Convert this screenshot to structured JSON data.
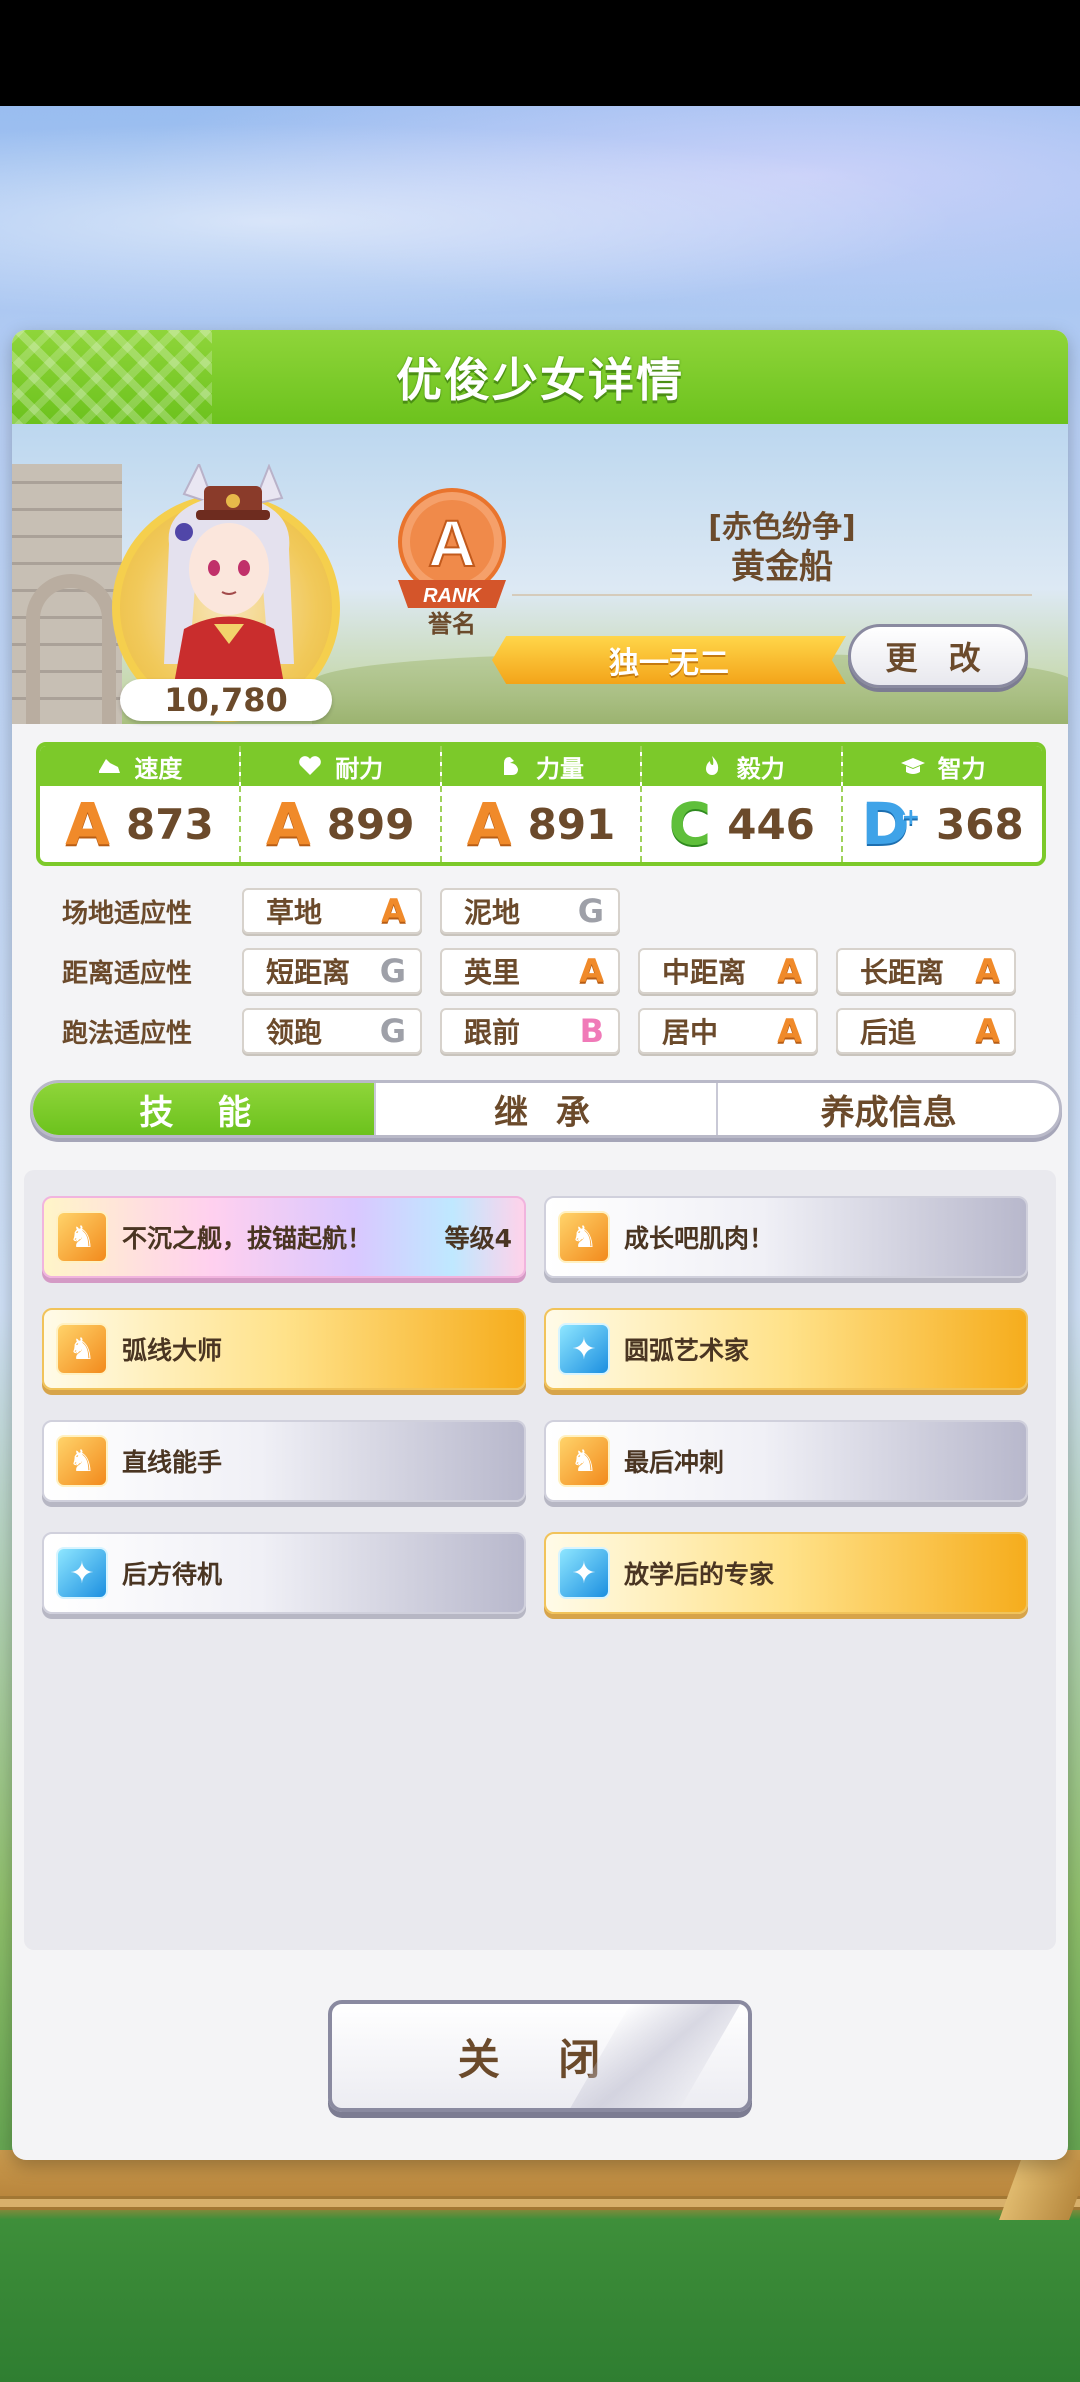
{
  "panel": {
    "title": "优俊少女详情"
  },
  "profile": {
    "score": "10,780",
    "rank": {
      "letter": "A",
      "label": "RANK",
      "caption": "誉名"
    },
    "epithet": "[赤色纷争]",
    "name": "黄金船",
    "title_ribbon": "独一无二",
    "change_button": "更 改"
  },
  "stats": [
    {
      "label": "速度",
      "icon": "shoe-icon",
      "grade": "A",
      "value": "873"
    },
    {
      "label": "耐力",
      "icon": "heart-icon",
      "grade": "A",
      "value": "899"
    },
    {
      "label": "力量",
      "icon": "muscle-icon",
      "grade": "A",
      "value": "891"
    },
    {
      "label": "毅力",
      "icon": "flame-icon",
      "grade": "C",
      "value": "446"
    },
    {
      "label": "智力",
      "icon": "graduation-cap-icon",
      "grade": "D",
      "grade_plus": "+",
      "value": "368"
    }
  ],
  "aptitude": {
    "track": {
      "label": "场地适应性",
      "items": [
        {
          "name": "草地",
          "grade": "A"
        },
        {
          "name": "泥地",
          "grade": "G"
        }
      ]
    },
    "distance": {
      "label": "距离适应性",
      "items": [
        {
          "name": "短距离",
          "grade": "G"
        },
        {
          "name": "英里",
          "grade": "A"
        },
        {
          "name": "中距离",
          "grade": "A"
        },
        {
          "name": "长距离",
          "grade": "A"
        }
      ]
    },
    "style": {
      "label": "跑法适应性",
      "items": [
        {
          "name": "领跑",
          "grade": "G"
        },
        {
          "name": "跟前",
          "grade": "B"
        },
        {
          "name": "居中",
          "grade": "A"
        },
        {
          "name": "后追",
          "grade": "A"
        }
      ]
    }
  },
  "tabs": [
    {
      "label": "技 能",
      "active": true
    },
    {
      "label": "继 承",
      "active": false
    },
    {
      "label": "养成信息",
      "active": false
    }
  ],
  "skills": [
    {
      "name": "不沉之舰，拔锚起航！",
      "level": "等级4",
      "style": "rainbow",
      "icon": "horse-shoe-icon"
    },
    {
      "name": "成长吧肌肉！",
      "level": "",
      "style": "white",
      "icon": "horse-shoe-icon"
    },
    {
      "name": "弧线大师",
      "level": "",
      "style": "gold",
      "icon": "horse-shoe-icon"
    },
    {
      "name": "圆弧艺术家",
      "level": "",
      "style": "gold",
      "icon": "sparkle-icon"
    },
    {
      "name": "直线能手",
      "level": "",
      "style": "white",
      "icon": "horse-shoe-icon"
    },
    {
      "name": "最后冲刺",
      "level": "",
      "style": "white",
      "icon": "horse-shoe-icon"
    },
    {
      "name": "后方待机",
      "level": "",
      "style": "white",
      "icon": "sparkle-icon"
    },
    {
      "name": "放学后的专家",
      "level": "",
      "style": "gold",
      "icon": "sparkle-icon"
    }
  ],
  "close_button": "关 闭",
  "colors": {
    "header_green": "#6cc21d",
    "text_brown": "#6b4a2b",
    "grade_A": "#f08a2a",
    "grade_C": "#5fbf3a",
    "grade_D": "#3fa3e8",
    "grade_B": "#f07ab8",
    "grade_G": "#9ea0a8"
  }
}
